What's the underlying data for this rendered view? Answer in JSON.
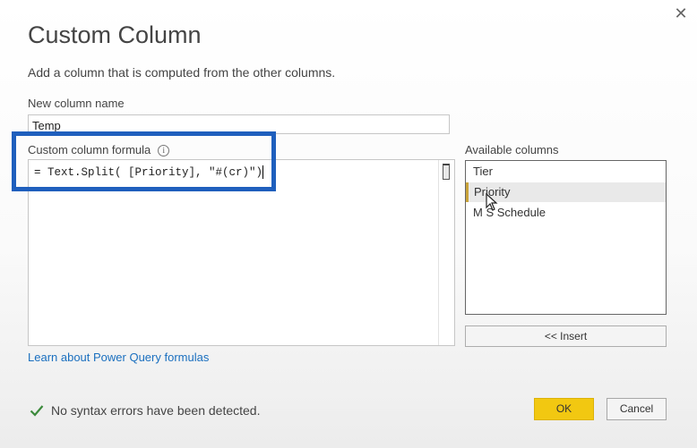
{
  "dialog": {
    "close_glyph": "✕",
    "title": "Custom Column",
    "subtitle": "Add a column that is computed from the other columns."
  },
  "new_column": {
    "label": "New column name",
    "value": "Temp"
  },
  "formula": {
    "label": "Custom column formula",
    "info_glyph": "i",
    "text": "= Text.Split( [Priority], \"#(cr)\")"
  },
  "available_columns": {
    "label": "Available columns",
    "items": [
      {
        "label": "Tier"
      },
      {
        "label": "Priority"
      },
      {
        "label": "M S Schedule"
      }
    ],
    "selected": "Priority"
  },
  "insert_label": "<< Insert",
  "learn_link": "Learn about Power Query formulas",
  "status": {
    "text": "No syntax errors have been detected.",
    "icon": "checkmark-icon",
    "color": "#3c8a3c"
  },
  "buttons": {
    "ok": "OK",
    "cancel": "Cancel"
  },
  "colors": {
    "accent": "#f2c811",
    "highlight_border": "#1f5fbd",
    "link": "#1a6fbf"
  }
}
